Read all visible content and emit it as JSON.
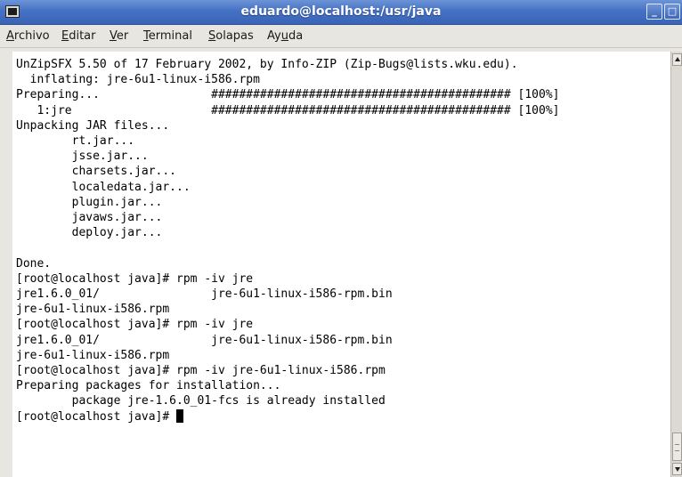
{
  "window": {
    "title": "eduardo@localhost:/usr/java",
    "minimize_label": "_",
    "maximize_label": "□",
    "close_label": "X"
  },
  "menubar": {
    "items": [
      {
        "label": "Archivo",
        "mnemonic": "A"
      },
      {
        "label": "Editar",
        "mnemonic": "E"
      },
      {
        "label": "Ver",
        "mnemonic": "V"
      },
      {
        "label": "Terminal",
        "mnemonic": "T"
      },
      {
        "label": "Solapas",
        "mnemonic": "S"
      },
      {
        "label": "Ayuda",
        "mnemonic": "u"
      }
    ]
  },
  "terminal": {
    "lines": [
      "UnZipSFX 5.50 of 17 February 2002, by Info-ZIP (Zip-Bugs@lists.wku.edu).",
      "  inflating: jre-6u1-linux-i586.rpm",
      "Preparing...                ########################################### [100%]",
      "   1:jre                    ########################################### [100%]",
      "Unpacking JAR files...",
      "        rt.jar...",
      "        jsse.jar...",
      "        charsets.jar...",
      "        localedata.jar...",
      "        plugin.jar...",
      "        javaws.jar...",
      "        deploy.jar...",
      "",
      "Done.",
      "[root@localhost java]# rpm -iv jre",
      "jre1.6.0_01/                jre-6u1-linux-i586-rpm.bin",
      "jre-6u1-linux-i586.rpm",
      "[root@localhost java]# rpm -iv jre",
      "jre1.6.0_01/                jre-6u1-linux-i586-rpm.bin",
      "jre-6u1-linux-i586.rpm",
      "[root@localhost java]# rpm -iv jre-6u1-linux-i586.rpm",
      "Preparing packages for installation...",
      "        package jre-1.6.0_01-fcs is already installed"
    ],
    "prompt": "[root@localhost java]# "
  },
  "colors": {
    "titlebar": "#4571c4",
    "menubar_bg": "#e8e6e1",
    "terminal_bg": "#ffffff",
    "terminal_fg": "#000000"
  }
}
